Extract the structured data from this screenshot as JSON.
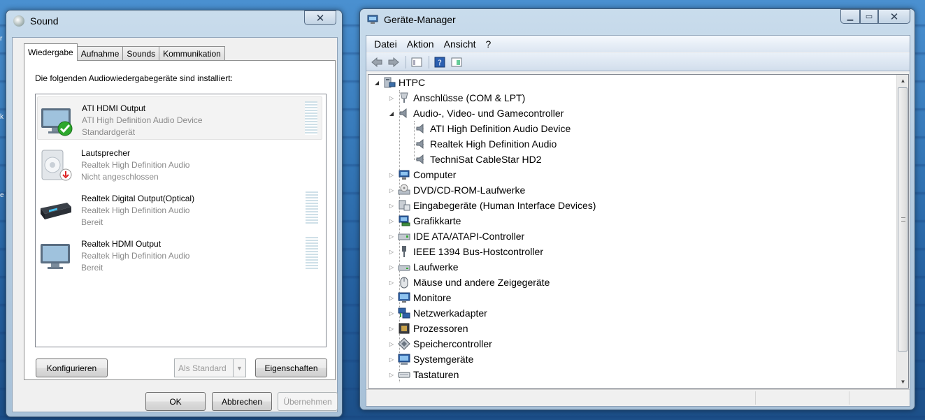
{
  "desktop": {
    "edge_text_1": "r",
    "edge_text_2": "k",
    "edge_text_3": "e"
  },
  "sound": {
    "title": "Sound",
    "tabs": [
      {
        "label": "Wiedergabe",
        "active": true
      },
      {
        "label": "Aufnahme",
        "active": false
      },
      {
        "label": "Sounds",
        "active": false
      },
      {
        "label": "Kommunikation",
        "active": false
      }
    ],
    "description": "Die folgenden Audiowiedergabegeräte sind installiert:",
    "devices": [
      {
        "name": "ATI HDMI Output",
        "driver": "ATI High Definition Audio Device",
        "status": "Standardgerät",
        "icon": "monitor-icon",
        "badge": "check-badge-icon",
        "selected": true,
        "meter": true
      },
      {
        "name": "Lautsprecher",
        "driver": "Realtek High Definition Audio",
        "status": "Nicht angeschlossen",
        "icon": "speaker-icon",
        "badge": "unplugged-badge-icon",
        "selected": false,
        "meter": false
      },
      {
        "name": "Realtek Digital Output(Optical)",
        "driver": "Realtek High Definition Audio",
        "status": "Bereit",
        "icon": "receiver-icon",
        "badge": "",
        "selected": false,
        "meter": true
      },
      {
        "name": "Realtek HDMI Output",
        "driver": "Realtek High Definition Audio",
        "status": "Bereit",
        "icon": "monitor-icon",
        "badge": "",
        "selected": false,
        "meter": true
      }
    ],
    "buttons": {
      "configure": "Konfigurieren",
      "set_default": "Als Standard",
      "properties": "Eigenschaften",
      "ok": "OK",
      "cancel": "Abbrechen",
      "apply": "Übernehmen"
    },
    "window_buttons": {
      "close": "✕"
    }
  },
  "devmgr": {
    "title": "Geräte-Manager",
    "menu": [
      "Datei",
      "Aktion",
      "Ansicht",
      "?"
    ],
    "toolbar_icons": [
      "back-arrow-icon",
      "forward-arrow-icon",
      "properties-view-icon",
      "help-icon",
      "device-view-icon"
    ],
    "tree": {
      "root": "HTPC",
      "nodes": [
        {
          "label": "Anschlüsse (COM & LPT)",
          "icon": "port-icon",
          "expanded": false
        },
        {
          "label": "Audio-, Video- und Gamecontroller",
          "icon": "audio-icon",
          "expanded": true,
          "children": [
            "ATI High Definition Audio Device",
            "Realtek High Definition Audio",
            "TechniSat CableStar HD2"
          ]
        },
        {
          "label": "Computer",
          "icon": "computer-icon",
          "expanded": false
        },
        {
          "label": "DVD/CD-ROM-Laufwerke",
          "icon": "dvd-icon",
          "expanded": false
        },
        {
          "label": "Eingabegeräte (Human Interface Devices)",
          "icon": "hid-icon",
          "expanded": false
        },
        {
          "label": "Grafikkarte",
          "icon": "display-adapter-icon",
          "expanded": false
        },
        {
          "label": "IDE ATA/ATAPI-Controller",
          "icon": "ide-icon",
          "expanded": false
        },
        {
          "label": "IEEE 1394 Bus-Hostcontroller",
          "icon": "firewire-icon",
          "expanded": false
        },
        {
          "label": "Laufwerke",
          "icon": "drive-icon",
          "expanded": false
        },
        {
          "label": "Mäuse und andere Zeigegeräte",
          "icon": "mouse-icon",
          "expanded": false
        },
        {
          "label": "Monitore",
          "icon": "monitor-icon",
          "expanded": false
        },
        {
          "label": "Netzwerkadapter",
          "icon": "network-icon",
          "expanded": false
        },
        {
          "label": "Prozessoren",
          "icon": "cpu-icon",
          "expanded": false
        },
        {
          "label": "Speichercontroller",
          "icon": "storage-controller-icon",
          "expanded": false
        },
        {
          "label": "Systemgeräte",
          "icon": "system-device-icon",
          "expanded": false
        },
        {
          "label": "Tastaturen",
          "icon": "keyboard-icon",
          "expanded": false
        }
      ]
    }
  }
}
